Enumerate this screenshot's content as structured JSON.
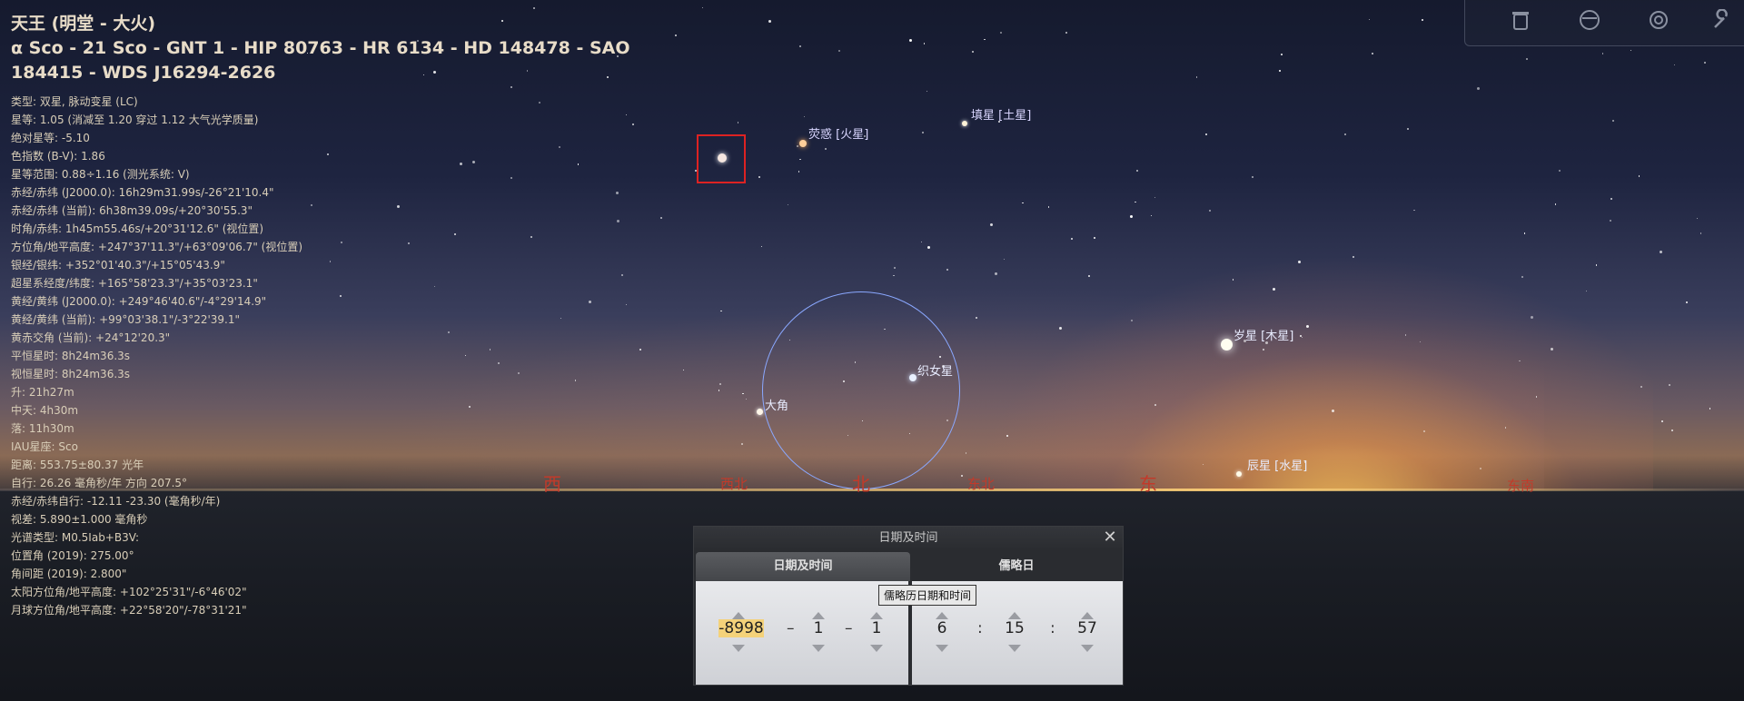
{
  "object": {
    "name": "天王 (明堂 - 大火)",
    "ids": "α Sco - 21 Sco - GNT 1 - HIP 80763 - HR 6134 - HD 148478 - SAO 184415 - WDS J16294-2626",
    "lines": [
      "类型: 双星, 脉动变星 (LC)",
      "星等: 1.05 (消减至 1.20 穿过 1.12 大气光学质量)",
      "绝对星等: -5.10",
      "色指数 (B-V): 1.86",
      "星等范围: 0.88÷1.16 (测光系统: V)",
      "赤经/赤纬 (J2000.0): 16h29m31.99s/-26°21'10.4\"",
      "赤经/赤纬 (当前): 6h38m39.09s/+20°30'55.3\"",
      "时角/赤纬: 1h45m55.46s/+20°31'12.6\" (视位置)",
      "方位角/地平高度: +247°37'11.3\"/+63°09'06.7\" (视位置)",
      "银经/银纬: +352°01'40.3\"/+15°05'43.9\"",
      "超星系经度/纬度: +165°58'23.3\"/+35°03'23.1\"",
      "黄经/黄纬 (J2000.0): +249°46'40.6\"/-4°29'14.9\"",
      "黄经/黄纬 (当前): +99°03'38.1\"/-3°22'39.1\"",
      "黄赤交角 (当前): +24°12'20.3\"",
      "平恒星时: 8h24m36.3s",
      "视恒星时: 8h24m36.3s",
      "升: 21h27m",
      "中天: 4h30m",
      "落: 11h30m",
      "IAU星座: Sco",
      "距离: 553.75±80.37 光年",
      "自行: 26.26 毫角秒/年 方向 207.5°",
      "赤经/赤纬自行: -12.11 -23.30 (毫角秒/年)",
      "视差: 5.890±1.000 毫角秒",
      "光谱类型: M0.5Iab+B3V:",
      "位置角 (2019): 275.00°",
      "角间距 (2019): 2.800\"",
      "太阳方位角/地平高度: +102°25'31\"/-6°46'02\"",
      "月球方位角/地平高度: +22°58'20\"/-78°31'21\""
    ]
  },
  "sky_labels": {
    "mars": "荧惑 [火星]",
    "saturn": "填星 [土星]",
    "jupiter": "岁星 [木星]",
    "mercury": "辰星 [水星]",
    "vega": "织女星",
    "arcturus": "大角"
  },
  "cardinals": {
    "west": "西",
    "northwest": "西北",
    "north": "北",
    "northeast": "东北",
    "east": "东",
    "southeast": "东南"
  },
  "toolbar": {
    "icons": [
      "trash-icon",
      "window-icon",
      "target-icon",
      "wrench-icon"
    ]
  },
  "dialog": {
    "title": "日期及时间",
    "close": "✕",
    "tab_datetime": "日期及时间",
    "tab_julian": "儒略日",
    "year": "-8998",
    "month": "1",
    "day": "1",
    "date_sep": "–",
    "hour": "6",
    "minute": "15",
    "second": "57",
    "time_sep": ":",
    "tooltip": "儒略历日期和时间"
  },
  "colors": {
    "cardinal": "#c23a2a",
    "selection_box": "#dd2222",
    "circle": "#8aa8ff",
    "info_text": "#e8dcc8"
  }
}
